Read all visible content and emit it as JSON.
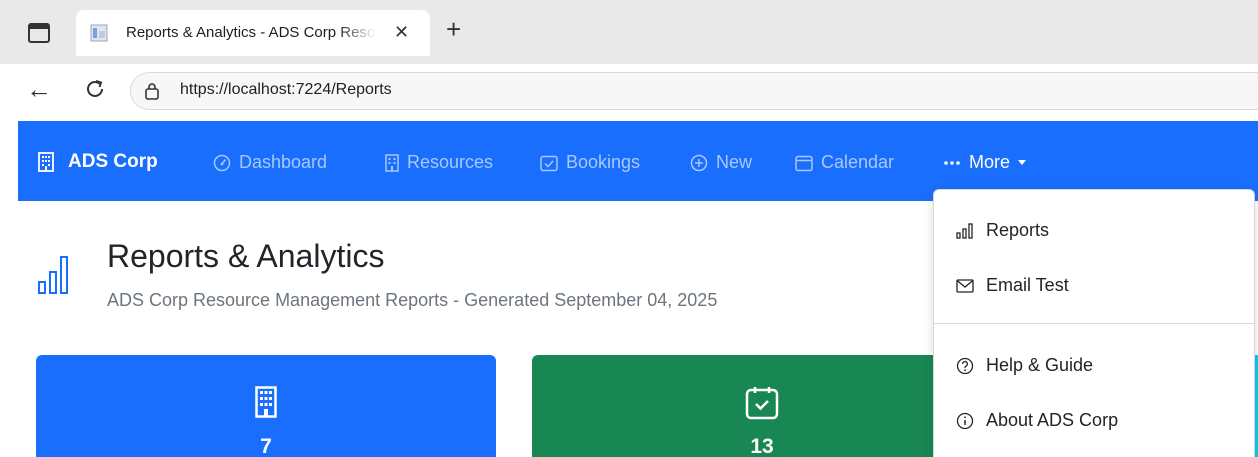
{
  "browser": {
    "tab_title": "Reports & Analytics - ADS Corp Resource Management",
    "tab_close": "✕",
    "new_tab": "+",
    "url": "https://localhost:7224/Reports"
  },
  "navbar": {
    "brand": "ADS Corp",
    "items": [
      {
        "label": "Dashboard",
        "icon": "speedometer-icon"
      },
      {
        "label": "Resources",
        "icon": "building-icon"
      },
      {
        "label": "Bookings",
        "icon": "calendar-check-icon"
      },
      {
        "label": "New",
        "icon": "plus-circle-icon"
      },
      {
        "label": "Calendar",
        "icon": "calendar-icon"
      }
    ],
    "more": {
      "label": "More",
      "icon": "three-dots-icon"
    }
  },
  "page": {
    "title": "Reports & Analytics",
    "subtitle": "ADS Corp Resource Management Reports - Generated September 04, 2025"
  },
  "cards": [
    {
      "value": "7",
      "icon": "building-icon",
      "color": "#1a6efd"
    },
    {
      "value": "13",
      "icon": "calendar-check-icon",
      "color": "#198754"
    }
  ],
  "dropdown": {
    "items": [
      {
        "label": "Reports",
        "icon": "bar-chart-icon"
      },
      {
        "label": "Email Test",
        "icon": "envelope-icon"
      },
      {
        "label": "Help & Guide",
        "icon": "question-circle-icon"
      },
      {
        "label": "About ADS Corp",
        "icon": "info-circle-icon"
      }
    ]
  },
  "colors": {
    "primary": "#1a6efd",
    "success": "#198754",
    "info": "#0dcaf0",
    "nav_inactive": "#a8c8ff"
  }
}
